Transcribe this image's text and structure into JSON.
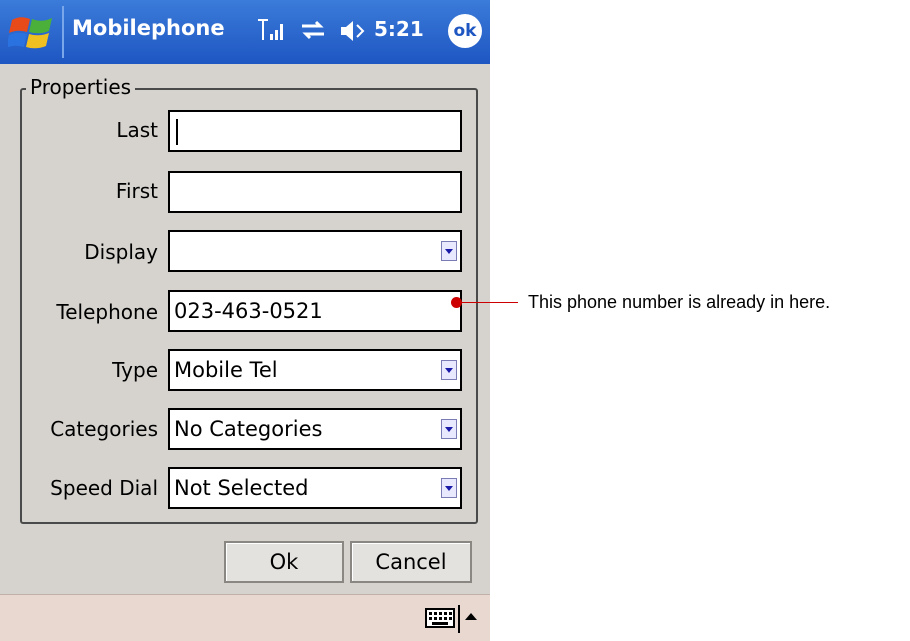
{
  "window": {
    "title": "Mobilephone",
    "time": "5:21",
    "ok_label": "ok"
  },
  "group": {
    "label": "Properties"
  },
  "fields": {
    "last": {
      "label": "Last",
      "value": ""
    },
    "first": {
      "label": "First",
      "value": ""
    },
    "display": {
      "label": "Display",
      "value": ""
    },
    "telephone": {
      "label": "Telephone",
      "value": "023-463-0521"
    },
    "type": {
      "label": "Type",
      "value": "Mobile Tel"
    },
    "categories": {
      "label": "Categories",
      "value": "No Categories"
    },
    "speed_dial": {
      "label": "Speed Dial",
      "value": "Not Selected"
    }
  },
  "buttons": {
    "ok": "Ok",
    "cancel": "Cancel"
  },
  "annotation": {
    "text": "This phone number is already in here."
  },
  "colors": {
    "titlebar": "#1e56c2",
    "dialog_bg": "#d6d3ce",
    "callout": "#cc0000"
  },
  "icons": [
    "windows-start-icon",
    "signal-icon",
    "sync-icon",
    "volume-icon",
    "ok-icon",
    "keyboard-icon",
    "up-arrow-icon"
  ]
}
